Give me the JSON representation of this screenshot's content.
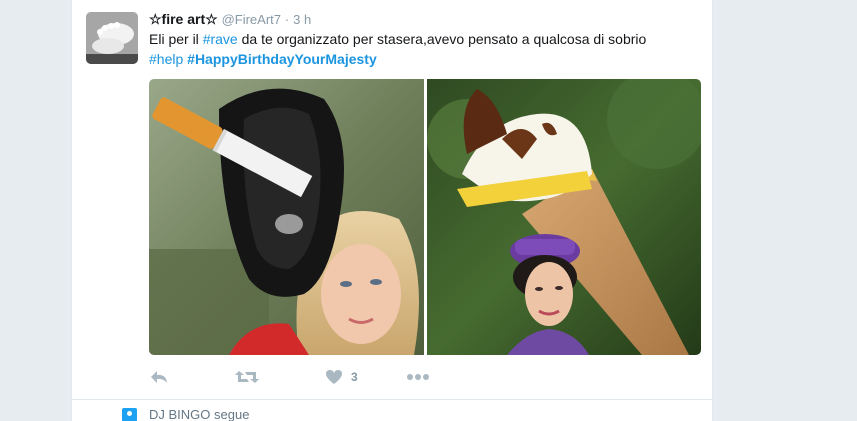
{
  "tweet": {
    "fullname": "☆fire art☆",
    "username": "@FireArt7",
    "separator": "·",
    "time": "3 h",
    "text_part1": "Eli per il ",
    "hashtag_rave": "#rave",
    "text_part2": " da te organizzato per stasera,avevo pensato a qualcosa di sobrio",
    "hashtag_help": "#help",
    "hashtag_birthday": "#HappyBirthdayYourMajesty",
    "actions": {
      "reply_icon": "reply-icon",
      "retweet_icon": "retweet-icon",
      "like_icon": "heart-icon",
      "like_count": "3",
      "more_icon": "more-icon"
    }
  },
  "notification": {
    "text": "DJ BINGO segue"
  },
  "colors": {
    "link": "#1b95e0",
    "muted": "#8899a6",
    "text": "#14171a",
    "background": "#e6ecf0",
    "accent": "#1da1f2"
  }
}
